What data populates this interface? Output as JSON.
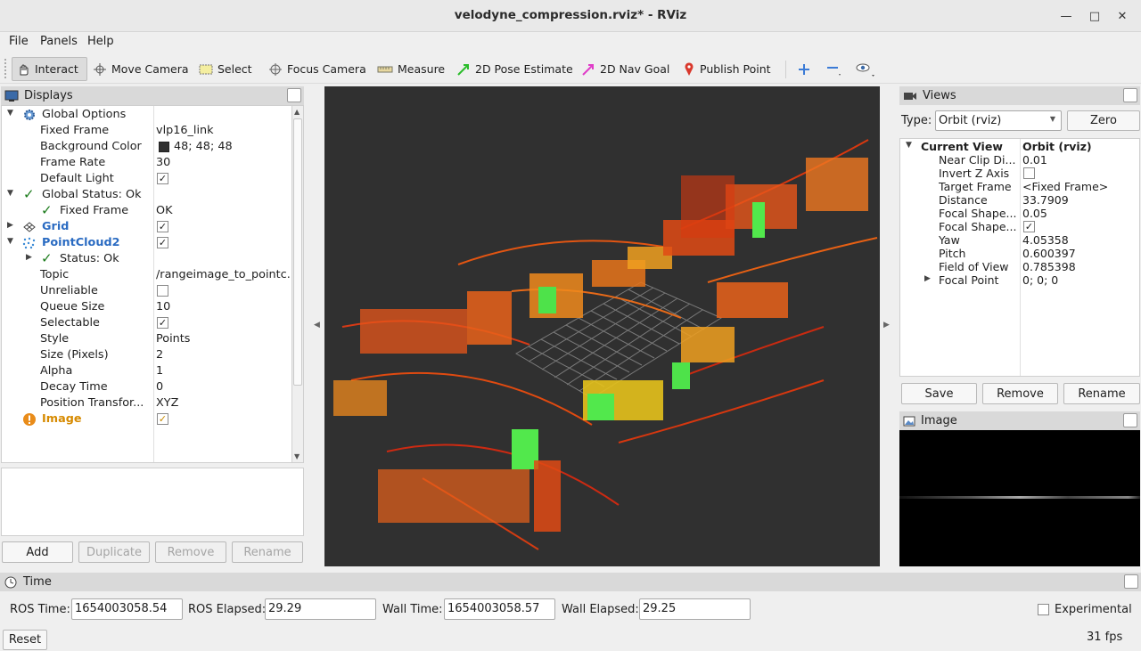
{
  "window": {
    "title": "velodyne_compression.rviz* - RViz"
  },
  "menu": [
    "File",
    "Panels",
    "Help"
  ],
  "toolbar": {
    "interact": "Interact",
    "move_camera": "Move Camera",
    "select": "Select",
    "focus_camera": "Focus Camera",
    "measure": "Measure",
    "pose_estimate": "2D Pose Estimate",
    "nav_goal": "2D Nav Goal",
    "publish_point": "Publish Point"
  },
  "displays": {
    "title": "Displays",
    "rows": [
      {
        "label": "Global Options",
        "value": ""
      },
      {
        "label": "Fixed Frame",
        "value": "vlp16_link"
      },
      {
        "label": "Background Color",
        "value": "48; 48; 48"
      },
      {
        "label": "Frame Rate",
        "value": "30"
      },
      {
        "label": "Default Light",
        "value": ""
      },
      {
        "label": "Global Status: Ok",
        "value": ""
      },
      {
        "label": "Fixed Frame",
        "value": "OK"
      },
      {
        "label": "Grid",
        "value": ""
      },
      {
        "label": "PointCloud2",
        "value": ""
      },
      {
        "label": "Status: Ok",
        "value": ""
      },
      {
        "label": "Topic",
        "value": "/rangeimage_to_pointc..."
      },
      {
        "label": "Unreliable",
        "value": ""
      },
      {
        "label": "Queue Size",
        "value": "10"
      },
      {
        "label": "Selectable",
        "value": ""
      },
      {
        "label": "Style",
        "value": "Points"
      },
      {
        "label": "Size (Pixels)",
        "value": "2"
      },
      {
        "label": "Alpha",
        "value": "1"
      },
      {
        "label": "Decay Time",
        "value": "0"
      },
      {
        "label": "Position Transfor...",
        "value": "XYZ"
      },
      {
        "label": "Image",
        "value": ""
      }
    ],
    "background_color": "#303030",
    "buttons": {
      "add": "Add",
      "duplicate": "Duplicate",
      "remove": "Remove",
      "rename": "Rename"
    }
  },
  "views": {
    "title": "Views",
    "type_label": "Type:",
    "type_value": "Orbit (rviz)",
    "zero": "Zero",
    "current_view": "Current View",
    "current_view_value": "Orbit (rviz)",
    "rows": [
      {
        "label": "Near Clip Di...",
        "value": "0.01"
      },
      {
        "label": "Invert Z Axis",
        "value": ""
      },
      {
        "label": "Target Frame",
        "value": "<Fixed Frame>"
      },
      {
        "label": "Distance",
        "value": "33.7909"
      },
      {
        "label": "Focal Shape...",
        "value": "0.05"
      },
      {
        "label": "Focal Shape...",
        "value": ""
      },
      {
        "label": "Yaw",
        "value": "4.05358"
      },
      {
        "label": "Pitch",
        "value": "0.600397"
      },
      {
        "label": "Field of View",
        "value": "0.785398"
      },
      {
        "label": "Focal Point",
        "value": "0; 0; 0"
      }
    ],
    "buttons": {
      "save": "Save",
      "remove": "Remove",
      "rename": "Rename"
    }
  },
  "image_panel": {
    "title": "Image"
  },
  "time": {
    "title": "Time",
    "ros_time_label": "ROS Time:",
    "ros_time": "1654003058.54",
    "ros_elapsed_label": "ROS Elapsed:",
    "ros_elapsed": "29.29",
    "wall_time_label": "Wall Time:",
    "wall_time": "1654003058.57",
    "wall_elapsed_label": "Wall Elapsed:",
    "wall_elapsed": "29.25",
    "experimental": "Experimental",
    "reset": "Reset",
    "fps": "31 fps"
  }
}
